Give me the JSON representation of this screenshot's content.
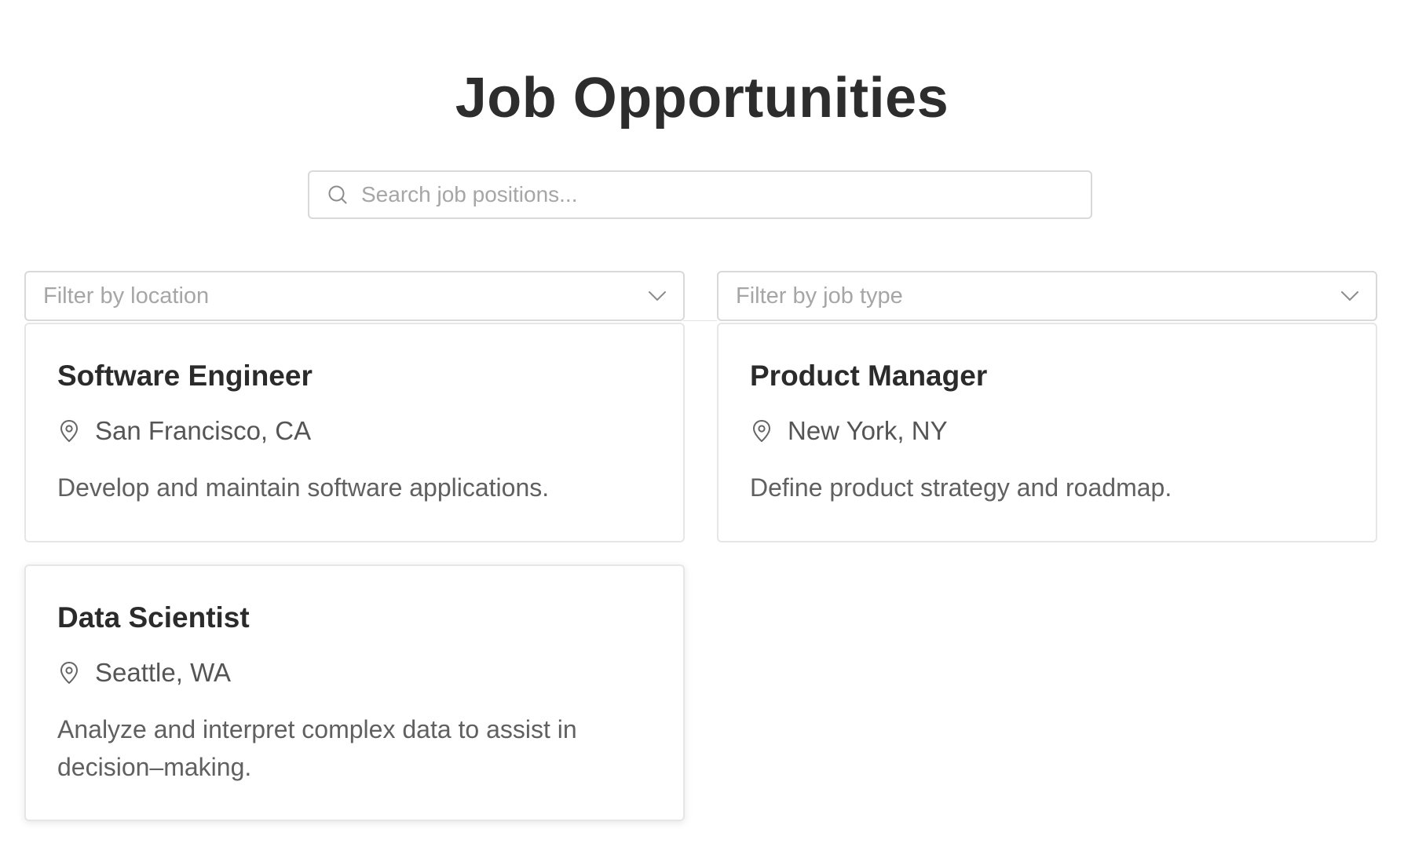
{
  "header": {
    "title": "Job Opportunities"
  },
  "search": {
    "placeholder": "Search job positions...",
    "icon": "search-icon"
  },
  "filters": {
    "location": {
      "placeholder": "Filter by location",
      "icon": "chevron-down-icon"
    },
    "job_type": {
      "placeholder": "Filter by job type",
      "icon": "chevron-down-icon"
    }
  },
  "jobs": [
    {
      "title": "Software Engineer",
      "location": "San Francisco, CA",
      "description": "Develop and maintain software applications.",
      "icon": "location-pin-icon"
    },
    {
      "title": "Product Manager",
      "location": "New York, NY",
      "description": "Define product strategy and roadmap.",
      "icon": "location-pin-icon"
    },
    {
      "title": "Data Scientist",
      "location": "Seattle, WA",
      "description": "Analyze and interpret complex data to assist in decision–making.",
      "icon": "location-pin-icon"
    }
  ],
  "colors": {
    "border": "#d9d9d9",
    "placeholder": "#a6a6a6",
    "title_text": "#2d2d2d",
    "body_text": "#606060"
  }
}
